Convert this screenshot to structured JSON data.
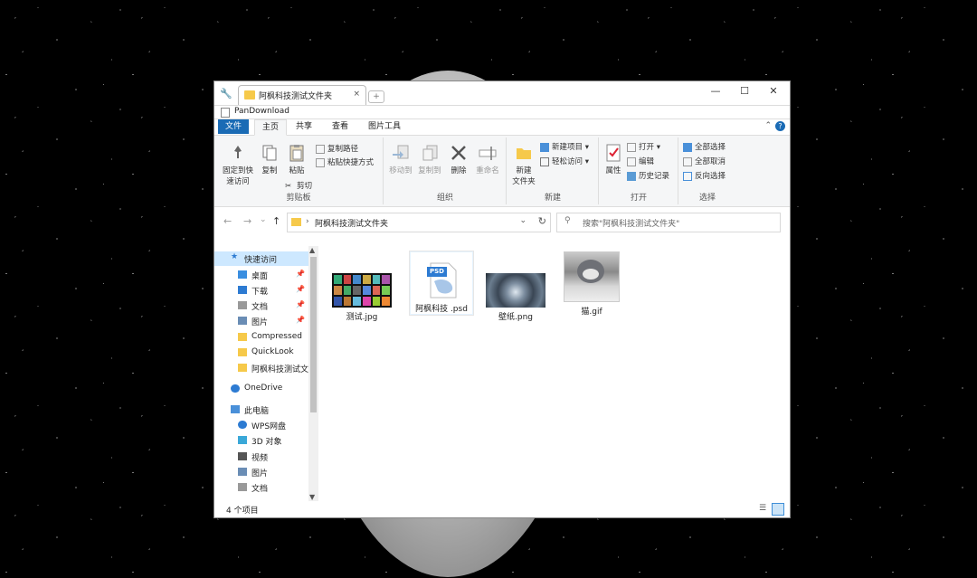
{
  "window": {
    "tab_title": "阿枫科技测试文件夹",
    "tab_close": "×",
    "new_tab": "+",
    "secondary_path": "PanDownload",
    "minimize": "—",
    "maximize": "☐",
    "close": "✕"
  },
  "ribbon": {
    "tabs": [
      "文件",
      "主页",
      "共享",
      "查看",
      "图片工具"
    ],
    "clipboard": {
      "pin": "固定到快\n速访问",
      "copy": "复制",
      "paste": "粘贴",
      "copy_path": "复制路径",
      "paste_shortcut": "粘贴快捷方式",
      "cut": "剪切",
      "label": "剪贴板"
    },
    "organize": {
      "move_to": "移动到",
      "copy_to": "复制到",
      "delete": "删除",
      "rename": "重命名",
      "label": "组织"
    },
    "new": {
      "new_item": "新建项目",
      "easy_access": "轻松访问",
      "new_folder": "新建\n文件夹",
      "label": "新建"
    },
    "open": {
      "properties": "属性",
      "open": "打开",
      "edit": "编辑",
      "history": "历史记录",
      "label": "打开"
    },
    "select": {
      "select_all": "全部选择",
      "select_none": "全部取消",
      "invert": "反向选择",
      "label": "选择"
    }
  },
  "nav": {
    "back": "←",
    "forward": "→",
    "recent": "⌄",
    "up": "↑",
    "path": "阿枫科技测试文件夹",
    "search_placeholder": "搜索\"阿枫科技测试文件夹\""
  },
  "sidebar": {
    "items": [
      {
        "label": "快速访问",
        "icon": "star-icon",
        "pinned": false
      },
      {
        "label": "桌面",
        "icon": "desktop-icon",
        "pinned": true
      },
      {
        "label": "下载",
        "icon": "download-icon",
        "pinned": true
      },
      {
        "label": "文档",
        "icon": "document-icon",
        "pinned": true
      },
      {
        "label": "图片",
        "icon": "picture-icon",
        "pinned": true
      },
      {
        "label": "Compressed",
        "icon": "folder-icon",
        "pinned": false
      },
      {
        "label": "QuickLook",
        "icon": "folder-icon",
        "pinned": false
      },
      {
        "label": "阿枫科技测试文",
        "icon": "folder-icon",
        "pinned": false
      },
      {
        "label": "OneDrive",
        "icon": "cloud-icon",
        "pinned": false
      },
      {
        "label": "此电脑",
        "icon": "computer-icon",
        "pinned": false
      },
      {
        "label": "WPS网盘",
        "icon": "cloud-icon",
        "pinned": false
      },
      {
        "label": "3D 对象",
        "icon": "cube-icon",
        "pinned": false
      },
      {
        "label": "视频",
        "icon": "video-icon",
        "pinned": false
      },
      {
        "label": "图片",
        "icon": "picture-icon",
        "pinned": false
      },
      {
        "label": "文档",
        "icon": "document-icon",
        "pinned": false
      }
    ]
  },
  "files": [
    {
      "name": "测试.jpg",
      "thumb": "grid-thumbnail"
    },
    {
      "name": "阿枫科技 .psd",
      "thumb": "psd-icon",
      "badge": "PSD"
    },
    {
      "name": "壁纸.png",
      "thumb": "wallpaper-thumbnail"
    },
    {
      "name": "猫.gif",
      "thumb": "cat-thumbnail"
    }
  ],
  "status": {
    "count": "4 个项目"
  },
  "colors": {
    "accent": "#1a6bb5",
    "folder": "#f6c94a",
    "selection": "#cde8ff"
  }
}
